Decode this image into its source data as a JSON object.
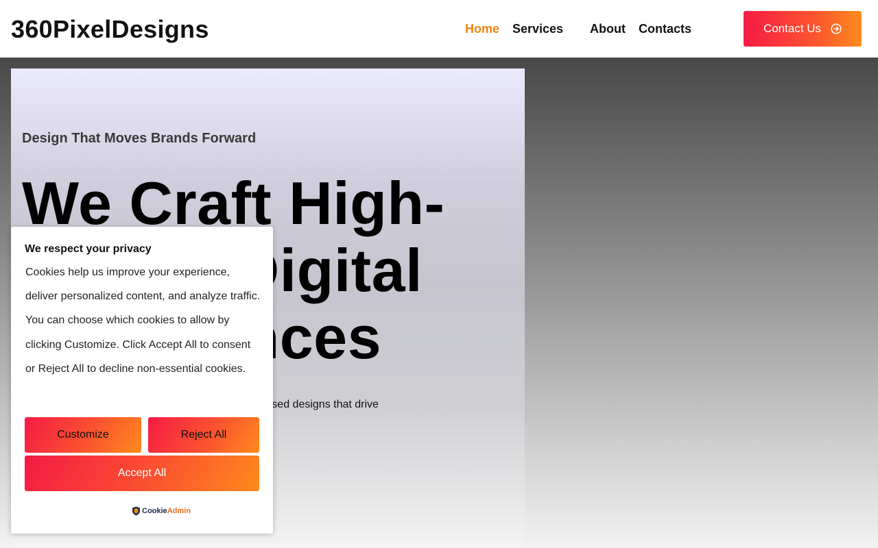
{
  "brand": {
    "logo": "360PixelDesigns"
  },
  "nav": {
    "items": [
      {
        "label": "Home",
        "active": true
      },
      {
        "label": "Services",
        "active": false
      },
      {
        "label": "About",
        "active": false
      },
      {
        "label": "Contacts",
        "active": false
      }
    ],
    "cta_label": "Contact Us"
  },
  "hero": {
    "tagline": "Design That Moves Brands Forward",
    "headline": "We Craft High-Impact Digital Experiences",
    "description": "We specialize in creating visually striking, user-focused designs that drive measurable business growth."
  },
  "cookie_banner": {
    "title": "We respect your privacy",
    "text": "Cookies help us improve your experience, deliver personalized content, and analyze traffic. You can choose which cookies to allow by clicking Customize. Click Accept All to consent or Reject All to decline non-essential cookies.",
    "customize_label": "Customize",
    "reject_label": "Reject All",
    "accept_label": "Accept All",
    "powered_by": {
      "part1": "Cookie",
      "part2": "Admin"
    }
  },
  "colors": {
    "accent": "#f0850f",
    "gradient_start": "#f61a45",
    "gradient_end": "#fe8c1b"
  },
  "icons": {
    "cta": "arrow-circle-right-icon",
    "powered": "shield-icon"
  }
}
